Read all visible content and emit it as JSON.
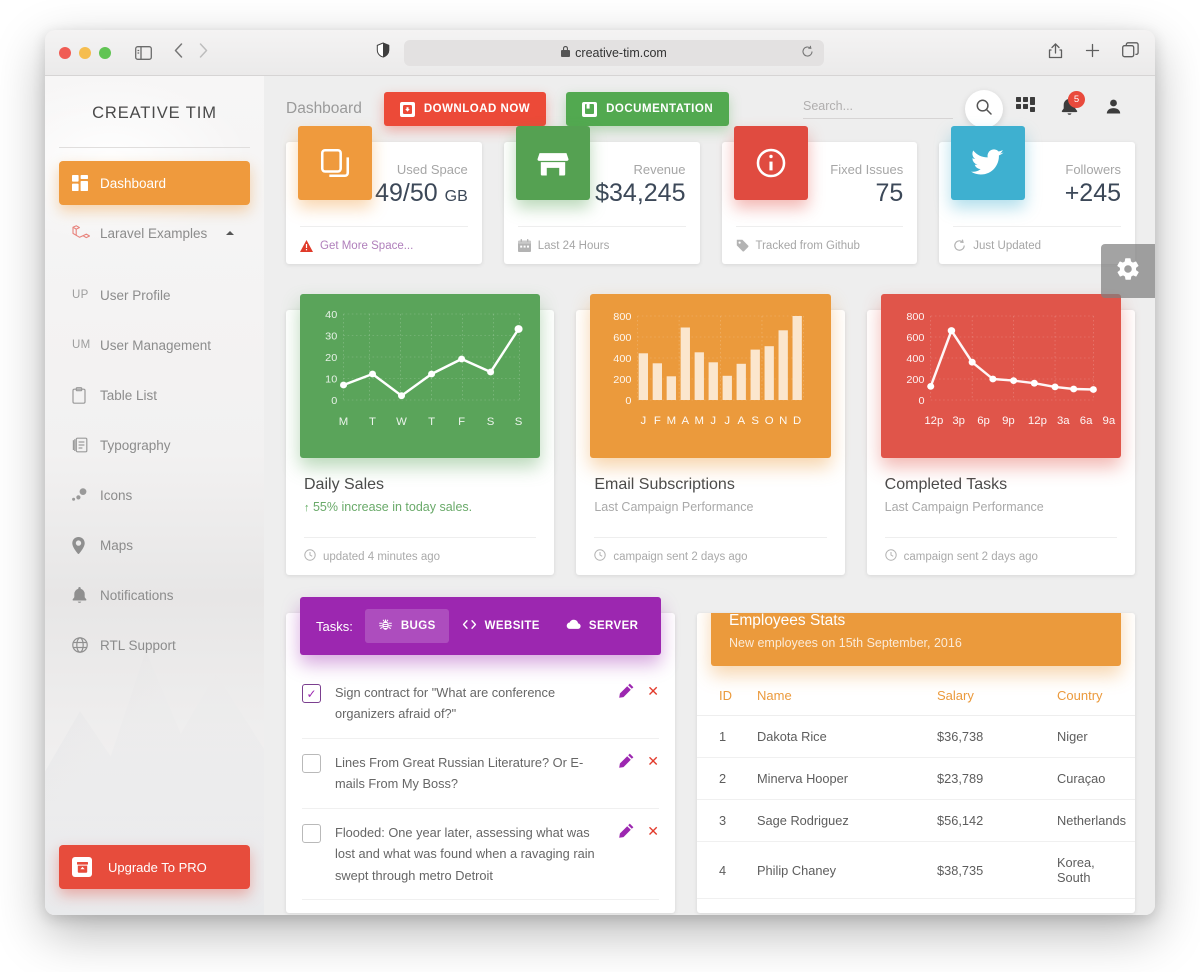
{
  "browser": {
    "url": "creative-tim.com",
    "lock_glyph": "🔒"
  },
  "sidebar": {
    "brand": "CREATIVE TIM",
    "items": [
      {
        "label": "Dashboard",
        "icon": "dashboard-icon",
        "active": true
      },
      {
        "label": "Laravel Examples",
        "icon": "laravel-icon",
        "active": false,
        "has_caret": true
      },
      {
        "label": "User Profile",
        "icon": "UP",
        "active": false
      },
      {
        "label": "User Management",
        "icon": "UM",
        "active": false
      },
      {
        "label": "Table List",
        "icon": "clipboard-icon",
        "active": false
      },
      {
        "label": "Typography",
        "icon": "typography-icon",
        "active": false
      },
      {
        "label": "Icons",
        "icon": "icons-icon",
        "active": false
      },
      {
        "label": "Maps",
        "icon": "map-pin-icon",
        "active": false
      },
      {
        "label": "Notifications",
        "icon": "bell-icon",
        "active": false
      },
      {
        "label": "RTL Support",
        "icon": "globe-icon",
        "active": false
      }
    ],
    "upgrade_label": "Upgrade To PRO"
  },
  "topbar": {
    "page_title": "Dashboard",
    "download_label": "DOWNLOAD NOW",
    "documentation_label": "DOCUMENTATION",
    "search_placeholder": "Search...",
    "notification_count": "5"
  },
  "stats": [
    {
      "label": "Used Space",
      "value": "49/50",
      "unit": "GB",
      "footer": "Get More Space...",
      "footer_icon": "warning-icon",
      "icon": "copy-icon",
      "color": "#ef9a3d"
    },
    {
      "label": "Revenue",
      "value": "$34,245",
      "unit": "",
      "footer": "Last 24 Hours",
      "footer_icon": "calendar-icon",
      "icon": "store-icon",
      "color": "#55a152"
    },
    {
      "label": "Fixed Issues",
      "value": "75",
      "unit": "",
      "footer": "Tracked from Github",
      "footer_icon": "tag-icon",
      "icon": "info-icon",
      "color": "#e04b40"
    },
    {
      "label": "Followers",
      "value": "+245",
      "unit": "",
      "footer": "Just Updated",
      "footer_icon": "refresh-icon",
      "icon": "twitter-icon",
      "color": "#3eb0d0"
    }
  ],
  "chart_cards": [
    {
      "title": "Daily Sales",
      "subtitle_prefix": "55%",
      "subtitle": "increase in today sales.",
      "footer": "updated 4 minutes ago",
      "color": "#5aa45a"
    },
    {
      "title": "Email Subscriptions",
      "subtitle": "Last Campaign Performance",
      "footer": "campaign sent 2 days ago",
      "color": "#eb9a3c"
    },
    {
      "title": "Completed Tasks",
      "subtitle": "Last Campaign Performance",
      "footer": "campaign sent 2 days ago",
      "color": "#e0554a"
    }
  ],
  "chart_data": [
    {
      "type": "line",
      "title": "Daily Sales",
      "categories": [
        "M",
        "T",
        "W",
        "T",
        "F",
        "S",
        "S"
      ],
      "values": [
        7,
        12,
        2,
        12,
        19,
        13,
        33
      ],
      "yticks": [
        0,
        10,
        20,
        30,
        40
      ],
      "ylim": [
        0,
        42
      ],
      "xlabel": "",
      "ylabel": "",
      "grid": true,
      "legend": "none",
      "color": "#ffffff",
      "background": "#5aa45a"
    },
    {
      "type": "bar",
      "title": "Email Subscriptions",
      "categories": [
        "J",
        "F",
        "M",
        "A",
        "M",
        "J",
        "J",
        "A",
        "S",
        "O",
        "N",
        "D"
      ],
      "values": [
        450,
        355,
        225,
        690,
        460,
        365,
        230,
        345,
        480,
        515,
        665,
        800
      ],
      "yticks": [
        0,
        200,
        400,
        600,
        800
      ],
      "ylim": [
        0,
        860
      ],
      "xlabel": "",
      "ylabel": "",
      "grid": true,
      "legend": "none",
      "color": "#fbe6cd",
      "background": "#eb9a3c"
    },
    {
      "type": "line",
      "title": "Completed Tasks",
      "categories": [
        "12p",
        "3p",
        "6p",
        "9p",
        "12p",
        "3a",
        "6a",
        "9a"
      ],
      "x_tick_positions": [
        0,
        1,
        2,
        3.5,
        5,
        6,
        7,
        8
      ],
      "values": [
        130,
        660,
        360,
        200,
        185,
        160,
        125,
        105,
        100
      ],
      "yticks": [
        0,
        200,
        400,
        600,
        800
      ],
      "ylim": [
        0,
        860
      ],
      "xlabel": "",
      "ylabel": "",
      "grid": true,
      "legend": "none",
      "color": "#ffffff",
      "background": "#e0554a"
    }
  ],
  "tasks": {
    "label": "Tasks:",
    "tabs": [
      {
        "label": "BUGS",
        "icon": "bug-icon",
        "active": true
      },
      {
        "label": "WEBSITE",
        "icon": "code-icon",
        "active": false
      },
      {
        "label": "SERVER",
        "icon": "cloud-icon",
        "active": false
      }
    ],
    "items": [
      {
        "text": "Sign contract for \"What are conference organizers afraid of?\"",
        "checked": true
      },
      {
        "text": "Lines From Great Russian Literature? Or E-mails From My Boss?",
        "checked": false
      },
      {
        "text": "Flooded: One year later, assessing what was lost and what was found when a ravaging rain swept through metro Detroit",
        "checked": false
      }
    ]
  },
  "employees": {
    "title": "Employees Stats",
    "subtitle": "New employees on 15th September, 2016",
    "columns": [
      "ID",
      "Name",
      "Salary",
      "Country"
    ],
    "rows": [
      [
        "1",
        "Dakota Rice",
        "$36,738",
        "Niger"
      ],
      [
        "2",
        "Minerva Hooper",
        "$23,789",
        "Curaçao"
      ],
      [
        "3",
        "Sage Rodriguez",
        "$56,142",
        "Netherlands"
      ],
      [
        "4",
        "Philip Chaney",
        "$38,735",
        "Korea, South"
      ]
    ]
  }
}
